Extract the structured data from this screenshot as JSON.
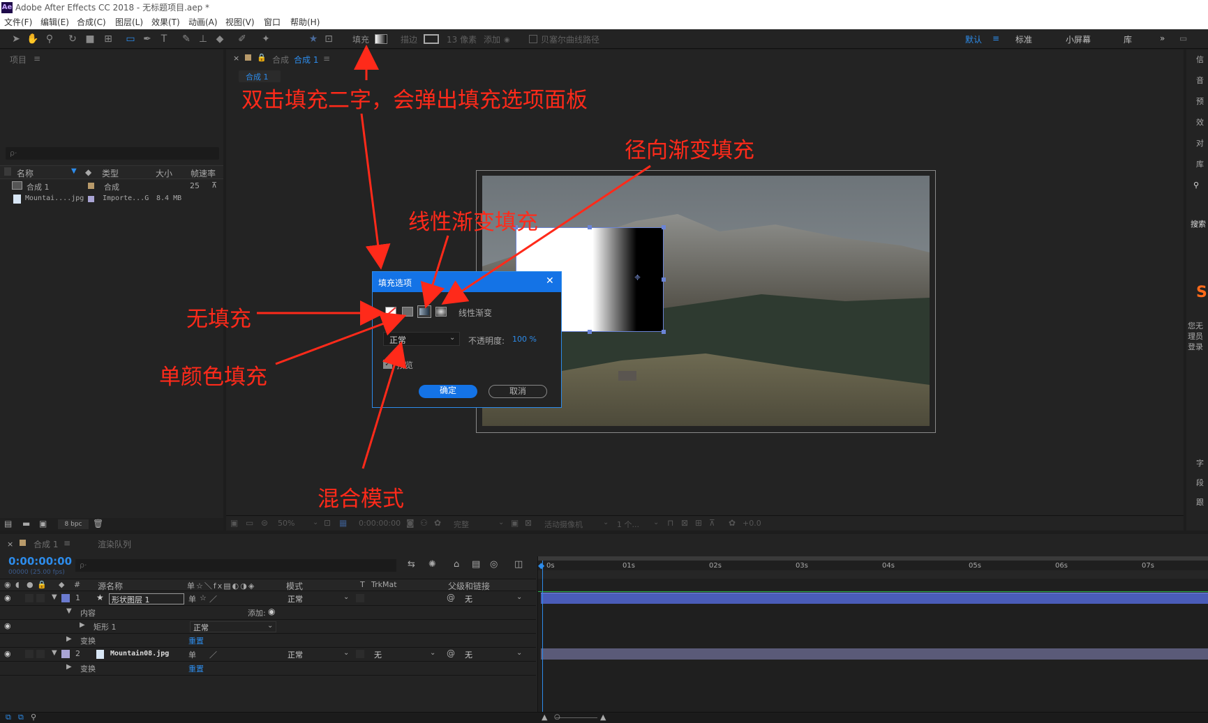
{
  "window": {
    "title": "Adobe After Effects CC 2018 - 无标题项目.aep *",
    "logo": "Ae"
  },
  "menu": [
    "文件(F)",
    "编辑(E)",
    "合成(C)",
    "图层(L)",
    "效果(T)",
    "动画(A)",
    "视图(V)",
    "窗口",
    "帮助(H)"
  ],
  "toolbar": {
    "fill_label": "填充",
    "stroke_label": "描边",
    "stroke_px": "13 像素",
    "add_label": "添加",
    "bezier_label": "贝塞尔曲线路径",
    "workspaces": [
      "默认",
      "标准",
      "小屏幕",
      "库"
    ],
    "workspace_menu_icon": "≡",
    "expand_icon": "»"
  },
  "project_panel": {
    "title": "项目",
    "search_icon": "ρ·",
    "columns": [
      "名称",
      "类型",
      "大小",
      "帧速率"
    ],
    "items": [
      {
        "name": "合成 1",
        "type": "合成",
        "size": "",
        "fps": "25"
      },
      {
        "name": "Mountai....jpg",
        "type": "Importe...G",
        "size": "8.4 MB",
        "fps": ""
      }
    ],
    "bpc": "8 bpc"
  },
  "comp_panel": {
    "header_label": "合成",
    "comp_name": "合成 1",
    "tab_label": "合成 1",
    "footer": {
      "zoom": "50%",
      "timecode": "0:00:00:00",
      "quality": "完整",
      "camera": "活动摄像机",
      "views": "1 个...",
      "exposure": "+0.0"
    }
  },
  "right_panel": {
    "items": [
      "信",
      "音",
      "预",
      "效",
      "对",
      "库",
      "字",
      "段",
      "跟"
    ],
    "search": "搜索",
    "text": [
      "您无",
      "理员",
      "登录"
    ]
  },
  "dialog": {
    "title": "填充选项",
    "close_icon": "✕",
    "gradient_label": "线性渐变",
    "blend_mode": "正常",
    "opacity_label": "不透明度:",
    "opacity_value": "100 %",
    "preview_label": "预览",
    "ok": "确定",
    "cancel": "取消"
  },
  "annotations": {
    "top": "双击填充二字，会弹出填充选项面板",
    "radial": "径向渐变填充",
    "linear": "线性渐变填充",
    "none": "无填充",
    "solid": "单颜色填充",
    "blend": "混合模式"
  },
  "timeline": {
    "comp_tab": "合成 1",
    "render_tab": "渲染队列",
    "timecode": "0:00:00:00",
    "fps_note": "00000 (25.00 fps)",
    "columns": {
      "num": "#",
      "source": "源名称",
      "mode": "模式",
      "t": "T",
      "trkmat": "TrkMat",
      "parent": "父级和链接"
    },
    "ruler": [
      "0s",
      "01s",
      "02s",
      "03s",
      "04s",
      "05s",
      "06s",
      "07s"
    ],
    "layers": [
      {
        "num": "1",
        "name": "形状图层 1",
        "mode": "正常",
        "trkmat": "",
        "parent": "无"
      },
      {
        "num": "2",
        "name": "Mountain08.jpg",
        "mode": "正常",
        "trkmat": "无",
        "parent": "无"
      }
    ],
    "sub_rows": {
      "content": "内容",
      "add": "添加:",
      "rect": "矩形 1",
      "rect_mode": "正常",
      "transform": "变换",
      "reset": "重置"
    }
  }
}
